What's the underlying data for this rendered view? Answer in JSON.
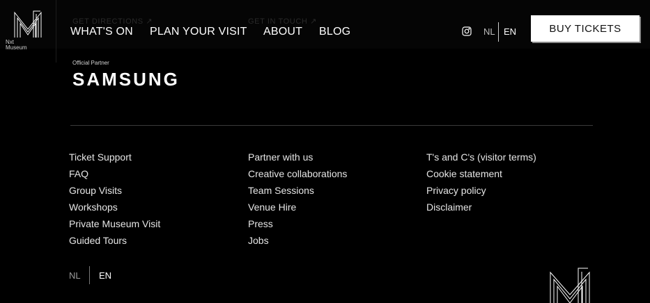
{
  "brand": {
    "name": "Nxt\nMuseum",
    "logo_icon": "nxt-museum-logo-icon"
  },
  "ghost_links": [
    "GET DIRECTIONS ↗",
    "GET IN TOUCH ↗"
  ],
  "nav": {
    "items": [
      "WHAT'S ON",
      "PLAN YOUR VISIT",
      "ABOUT",
      "BLOG"
    ]
  },
  "header": {
    "instagram_icon": "instagram-icon",
    "lang_nl": "NL",
    "lang_en": "EN",
    "buy_tickets": "BUY TICKETS"
  },
  "partner": {
    "label": "Official Partner",
    "name": "SAMSUNG"
  },
  "footer": {
    "col1": [
      "Ticket Support",
      "FAQ",
      "Group Visits",
      "Workshops",
      "Private Museum Visit",
      "Guided Tours"
    ],
    "col2": [
      "Partner with us",
      "Creative collaborations",
      "Team Sessions",
      "Venue Hire",
      "Press",
      "Jobs"
    ],
    "col3": [
      "T's and C's (visitor terms)",
      "Cookie statement",
      "Privacy policy",
      "Disclaimer"
    ],
    "lang_nl": "NL",
    "lang_en": "EN"
  },
  "colors": {
    "background": "#000000",
    "text": "#ffffff",
    "button_bg": "#ffffff",
    "button_text": "#111111"
  }
}
